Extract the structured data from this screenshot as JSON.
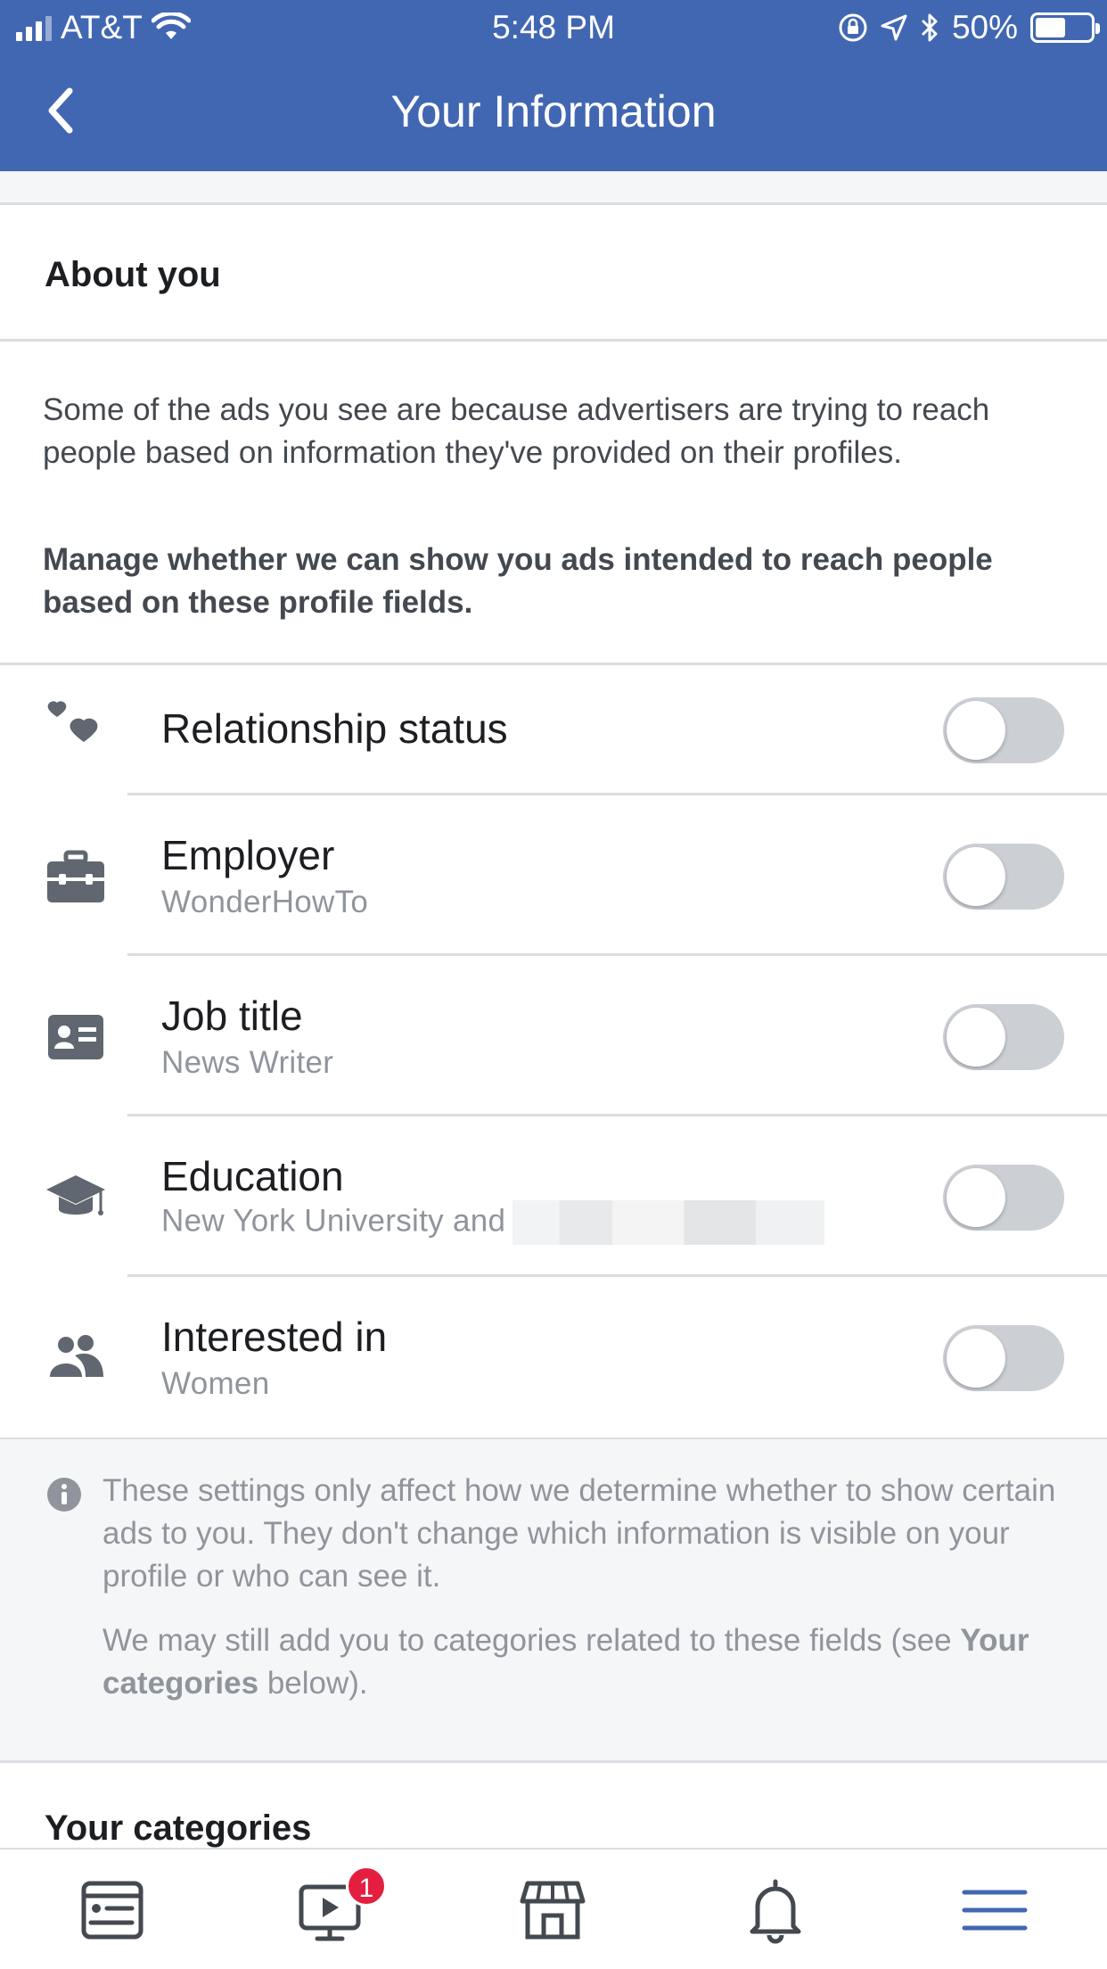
{
  "status_bar": {
    "carrier": "AT&T",
    "time": "5:48 PM",
    "battery": "50%",
    "battery_level": 0.5
  },
  "header": {
    "title": "Your Information",
    "back_icon": "chevron-left-icon",
    "background": "#4267b2"
  },
  "about": {
    "title": "About you",
    "description": "Some of the ads you see are because advertisers are trying to reach people based on information they've provided on their profiles.",
    "manage_text": "Manage whether we can show you ads intended to reach people based on these profile fields."
  },
  "fields": [
    {
      "icon": "hearts-icon",
      "label": "Relationship status",
      "value": "",
      "enabled": false
    },
    {
      "icon": "briefcase-icon",
      "label": "Employer",
      "value": "WonderHowTo",
      "enabled": false
    },
    {
      "icon": "id-card-icon",
      "label": "Job title",
      "value": "News Writer",
      "enabled": false
    },
    {
      "icon": "graduation-cap-icon",
      "label": "Education",
      "value": "New York University and",
      "enabled": false
    },
    {
      "icon": "people-icon",
      "label": "Interested in",
      "value": "Women",
      "enabled": false
    }
  ],
  "info": {
    "icon": "info-icon",
    "paragraph1": "These settings only affect how we determine whether to show certain ads to you. They don't change which information is visible on your profile or who can see it.",
    "paragraph2_prefix": "We may still add you to categories related to these fields (see ",
    "paragraph2_link": "Your categories",
    "paragraph2_suffix": " below)."
  },
  "categories": {
    "title": "Your categories"
  },
  "tabbar": {
    "items": [
      {
        "icon": "news-feed-icon",
        "active": false
      },
      {
        "icon": "watch-icon",
        "active": false,
        "badge": "1"
      },
      {
        "icon": "marketplace-icon",
        "active": false
      },
      {
        "icon": "notifications-bell-icon",
        "active": false
      },
      {
        "icon": "menu-icon",
        "active": true
      }
    ],
    "active_color": "#4267b2",
    "inactive_color": "#444950"
  }
}
